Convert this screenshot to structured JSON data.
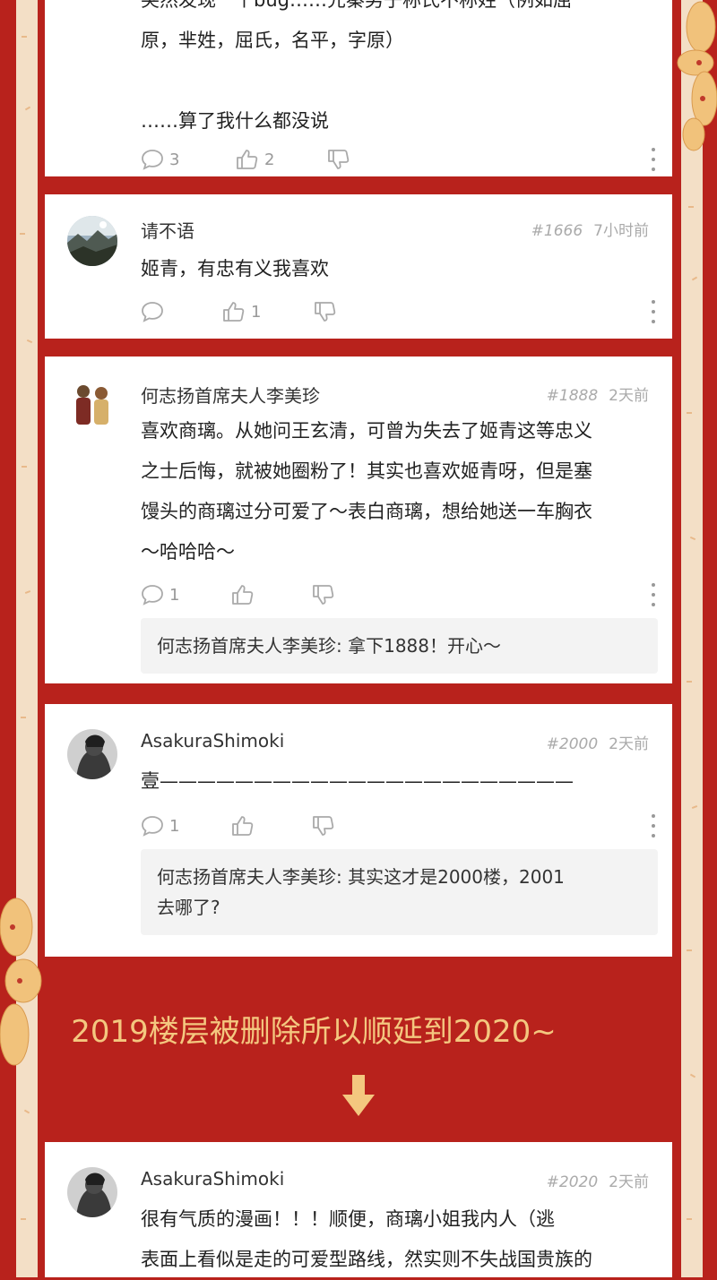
{
  "colors": {
    "background": "#b8221c",
    "strip": "#f3dfc6",
    "notice_text": "#f4c77f"
  },
  "comments": [
    {
      "text_lines": [
        "突然发现一个bug……先秦男子称氏不称姓（例如屈",
        "原，芈姓，屈氏，名平，字原）",
        "",
        "……算了我什么都没说"
      ],
      "comment_count": "3",
      "like_count": "2"
    },
    {
      "username": "请不语",
      "floor": "#1666",
      "time": "7小时前",
      "text": "姬青，有忠有义我喜欢",
      "like_count": "1",
      "avatar": "landscape-avatar"
    },
    {
      "username": "何志扬首席夫人李美珍",
      "floor": "#1888",
      "time": "2天前",
      "text_lines": [
        "喜欢商璃。从她问王玄清，可曾为失去了姬青这等忠义",
        "之士后悔，就被她圈粉了！其实也喜欢姬青呀，但是塞",
        "馒头的商璃过分可爱了～表白商璃，想给她送一车胸衣",
        "～哈哈哈～"
      ],
      "comment_count": "1",
      "reply": "何志扬首席夫人李美珍: 拿下1888！开心～",
      "avatar": "couple-avatar"
    },
    {
      "username": "AsakuraShimoki",
      "floor": "#2000",
      "time": "2天前",
      "text": "壹——————————————————————",
      "comment_count": "1",
      "reply_lines": [
        "何志扬首席夫人李美珍: 其实这才是2000楼，2001",
        "去哪了?"
      ],
      "avatar": "dark-avatar"
    },
    {
      "username": "AsakuraShimoki",
      "floor": "#2020",
      "time": "2天前",
      "text_lines": [
        "很有气质的漫画！！！顺便，商璃小姐我内人（逃",
        "表面上看似是走的可爱型路线，然实则不失战国贵族的"
      ],
      "avatar": "dark-avatar"
    }
  ],
  "notice": "2019楼层被删除所以顺延到2020~",
  "icons": [
    "comment-icon",
    "thumbs-up-icon",
    "thumbs-down-icon",
    "more-icon",
    "arrow-down-icon",
    "flower-icon"
  ]
}
